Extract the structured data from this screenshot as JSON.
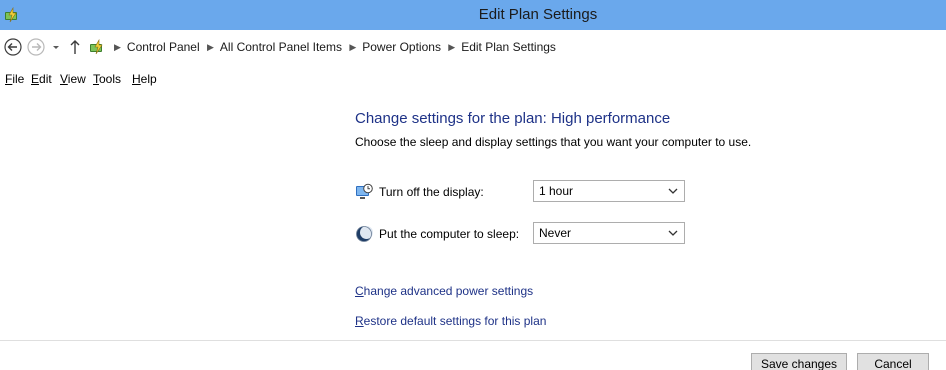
{
  "window": {
    "title": "Edit Plan Settings",
    "app_icon": "power-options-icon"
  },
  "address": {
    "back_icon": "back-arrow-icon",
    "forward_icon": "forward-arrow-icon",
    "dropdown_icon": "chevron-down-icon",
    "up_icon": "up-arrow-icon",
    "crumbs": [
      "Control Panel",
      "All Control Panel Items",
      "Power Options",
      "Edit Plan Settings"
    ]
  },
  "menu": {
    "items": [
      {
        "accel": "F",
        "rest": "ile"
      },
      {
        "accel": "E",
        "rest": "dit"
      },
      {
        "accel": "V",
        "rest": "iew"
      },
      {
        "accel": "T",
        "rest": "ools"
      },
      {
        "accel": "H",
        "rest": "elp"
      }
    ]
  },
  "main": {
    "heading": "Change settings for the plan: High performance",
    "subheading": "Choose the sleep and display settings that you want your computer to use.",
    "display": {
      "label": "Turn off the display:",
      "value": "1 hour",
      "icon": "monitor-clock-icon"
    },
    "sleep": {
      "label": "Put the computer to sleep:",
      "value": "Never",
      "icon": "moon-icon"
    },
    "links": {
      "advanced_accel": "C",
      "advanced_rest": "hange advanced power settings",
      "restore_accel": "R",
      "restore_rest": "estore default settings for this plan"
    }
  },
  "buttons": {
    "save": "Save changes",
    "cancel": "Cancel"
  },
  "colors": {
    "titlebar": "#6aa8ec",
    "link": "#1e3287",
    "heading": "#1e3287"
  }
}
